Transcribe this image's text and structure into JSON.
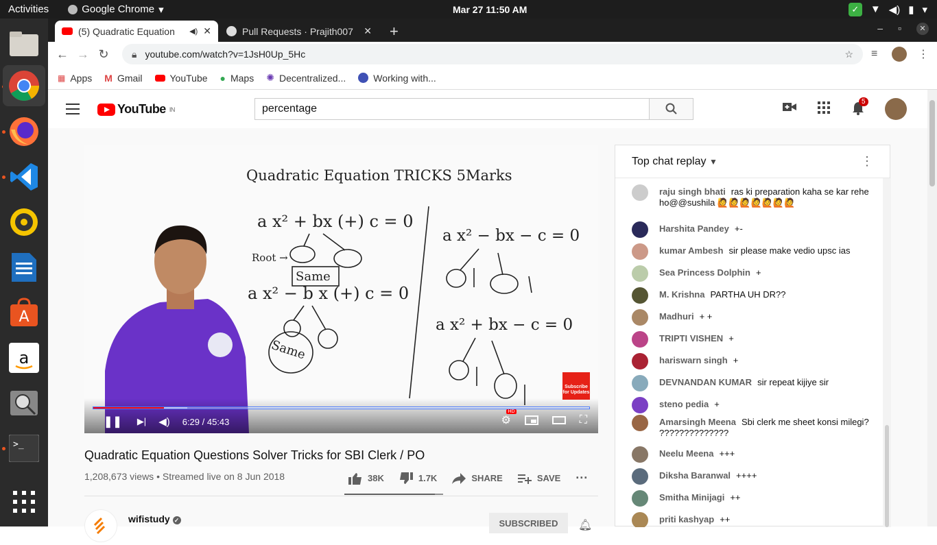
{
  "os": {
    "activities": "Activities",
    "app_name": "Google Chrome",
    "clock": "Mar 27  11:50 AM"
  },
  "browser": {
    "tabs": [
      {
        "title": "(5) Quadratic Equation"
      },
      {
        "title": "Pull Requests · Prajith007"
      }
    ],
    "url": "youtube.com/watch?v=1JsH0Up_5Hc",
    "bookmarks": [
      "Apps",
      "Gmail",
      "YouTube",
      "Maps",
      "Decentralized...",
      "Working with..."
    ]
  },
  "youtube": {
    "logo": "YouTube",
    "region": "IN",
    "search_value": "percentage",
    "notification_count": "5"
  },
  "player": {
    "time": "6:29 / 45:43",
    "progress": 0.142,
    "buffered": 0.19,
    "hd_badge": "HD",
    "watermark": "Subscribe for Updates",
    "board": {
      "title": "Quadratic Equation TRICKS 5Marks",
      "eq1": "a x² + bx (+) c = 0",
      "root_label": "Root →",
      "same1": "Same",
      "eq2": "a x² − b x (+) c = 0",
      "same2": "Same",
      "eq3": "a x² − bx − c = 0",
      "eq4": "a x² + bx − c = 0"
    }
  },
  "video": {
    "title": "Quadratic Equation Questions Solver Tricks for SBI Clerk / PO",
    "meta": "1,208,673 views • Streamed live on 8 Jun 2018",
    "likes": "38K",
    "dislikes": "1.7K",
    "share": "SHARE",
    "save": "SAVE",
    "like_ratio": 0.92,
    "channel": "wifistudy",
    "subscribed": "SUBSCRIBED"
  },
  "chat": {
    "header": "Top chat replay",
    "messages": [
      {
        "author": "raju singh bhati",
        "text": "ras ki preparation kaha se kar rehe ho@@sushila 🙋🙋🙋🙋🙋🙋🙋",
        "color": "#ccc"
      },
      {
        "author": "Harshita Pandey",
        "text": "+-",
        "color": "#2a2a5a"
      },
      {
        "author": "kumar Ambesh",
        "text": "sir please make vedio upsc ias",
        "color": "#c98"
      },
      {
        "author": "Sea Princess Dolphin",
        "text": "+",
        "color": "#bca"
      },
      {
        "author": "M. Krishna",
        "text": "PARTHA UH DR??",
        "color": "#553"
      },
      {
        "author": "Madhuri",
        "text": "+ +",
        "color": "#a86"
      },
      {
        "author": "TRIPTI VISHEN",
        "text": "+",
        "color": "#b48"
      },
      {
        "author": "hariswarn singh",
        "text": "+",
        "color": "#a23"
      },
      {
        "author": "DEVNANDAN KUMAR",
        "text": "sir repeat kijiye sir",
        "color": "#8ab"
      },
      {
        "author": "steno pedia",
        "text": "+",
        "color": "#7b3fc4"
      },
      {
        "author": "Amarsingh Meena",
        "text": "Sbi clerk me sheet konsi milegi? ??????????????",
        "color": "#964"
      },
      {
        "author": "Neelu Meena",
        "text": "+++",
        "color": "#876"
      },
      {
        "author": "Diksha Baranwal",
        "text": "++++",
        "color": "#5a6b7c"
      },
      {
        "author": "Smitha Minijagi",
        "text": "++",
        "color": "#687"
      },
      {
        "author": "priti kashyap",
        "text": "++",
        "color": "#a85"
      }
    ]
  }
}
